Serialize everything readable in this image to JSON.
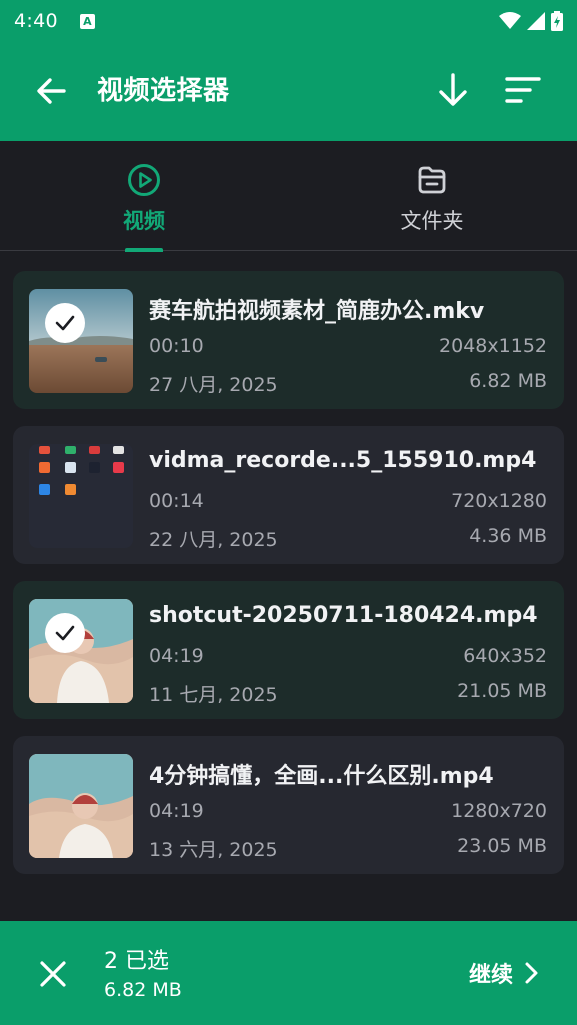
{
  "status_bar": {
    "time": "4:40",
    "notification_glyph": "A",
    "icons": [
      "wifi-icon",
      "signal-icon",
      "battery-icon"
    ]
  },
  "app_bar": {
    "title": "视频选择器",
    "icons": [
      "back-arrow-icon",
      "download-icon",
      "sort-icon"
    ]
  },
  "tabs": [
    {
      "label": "视频",
      "icon": "play-circle-icon",
      "active": true
    },
    {
      "label": "文件夹",
      "icon": "folder-icon",
      "active": false
    }
  ],
  "videos": [
    {
      "name": "赛车航拍视频素材_简鹿办公.mkv",
      "duration": "00:10",
      "resolution": "2048x1152",
      "date": "27 八月, 2025",
      "size": "6.82 MB",
      "selected": true
    },
    {
      "name": "vidma_recorde...5_155910.mp4",
      "duration": "00:14",
      "resolution": "720x1280",
      "date": "22 八月, 2025",
      "size": "4.36 MB",
      "selected": false
    },
    {
      "name": "shotcut-20250711-180424.mp4",
      "duration": "04:19",
      "resolution": "640x352",
      "date": "11 七月, 2025",
      "size": "21.05 MB",
      "selected": true
    },
    {
      "name": "4分钟搞懂，全画...什么区别.mp4",
      "duration": "04:19",
      "resolution": "1280x720",
      "date": "13 六月, 2025",
      "size": "23.05 MB",
      "selected": false
    }
  ],
  "bottom_bar": {
    "selected_count": "2 已选",
    "selected_size": "6.82 MB",
    "continue_label": "继续"
  },
  "colors": {
    "accent": "#0a9e6a",
    "tab_active": "#12a877",
    "background": "#1c1d22",
    "card": "#262830",
    "card_selected": "#1d2c2a"
  }
}
